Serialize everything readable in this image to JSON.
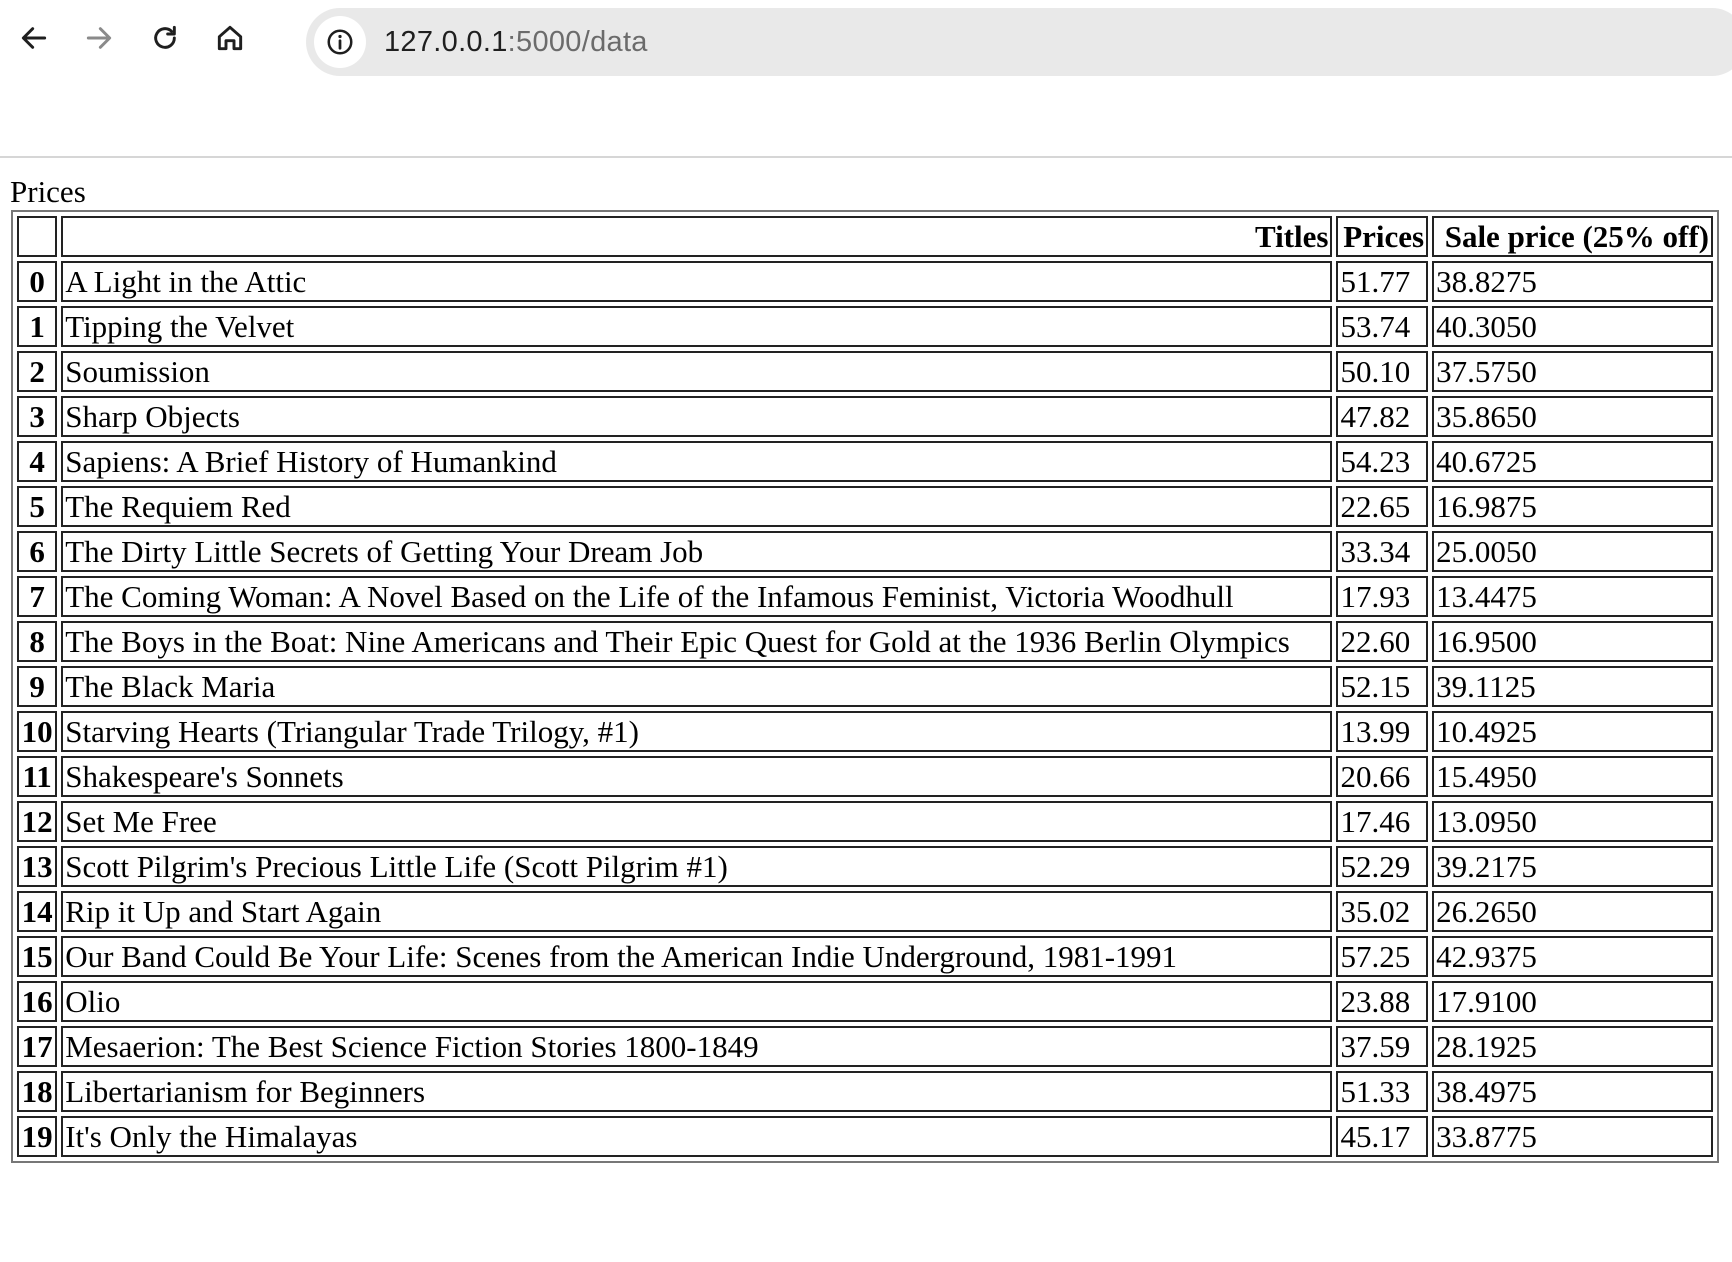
{
  "browser": {
    "back_icon": "arrow-left-icon",
    "forward_icon": "arrow-right-icon",
    "reload_icon": "reload-icon",
    "home_icon": "home-icon",
    "site_info_icon": "info-icon",
    "url_host": "127.0.0.1",
    "url_path": ":5000/data"
  },
  "page": {
    "caption": "Prices",
    "columns": [
      "",
      "Titles",
      "Prices",
      "Sale price (25% off)"
    ],
    "rows": [
      [
        "0",
        "A Light in the Attic",
        "51.77",
        "38.8275"
      ],
      [
        "1",
        "Tipping the Velvet",
        "53.74",
        "40.3050"
      ],
      [
        "2",
        "Soumission",
        "50.10",
        "37.5750"
      ],
      [
        "3",
        "Sharp Objects",
        "47.82",
        "35.8650"
      ],
      [
        "4",
        "Sapiens: A Brief History of Humankind",
        "54.23",
        "40.6725"
      ],
      [
        "5",
        "The Requiem Red",
        "22.65",
        "16.9875"
      ],
      [
        "6",
        "The Dirty Little Secrets of Getting Your Dream Job",
        "33.34",
        "25.0050"
      ],
      [
        "7",
        "The Coming Woman: A Novel Based on the Life of the Infamous Feminist, Victoria Woodhull",
        "17.93",
        "13.4475"
      ],
      [
        "8",
        "The Boys in the Boat: Nine Americans and Their Epic Quest for Gold at the 1936 Berlin Olympics",
        "22.60",
        "16.9500"
      ],
      [
        "9",
        "The Black Maria",
        "52.15",
        "39.1125"
      ],
      [
        "10",
        "Starving Hearts (Triangular Trade Trilogy, #1)",
        "13.99",
        "10.4925"
      ],
      [
        "11",
        "Shakespeare's Sonnets",
        "20.66",
        "15.4950"
      ],
      [
        "12",
        "Set Me Free",
        "17.46",
        "13.0950"
      ],
      [
        "13",
        "Scott Pilgrim's Precious Little Life (Scott Pilgrim #1)",
        "52.29",
        "39.2175"
      ],
      [
        "14",
        "Rip it Up and Start Again",
        "35.02",
        "26.2650"
      ],
      [
        "15",
        "Our Band Could Be Your Life: Scenes from the American Indie Underground, 1981-1991",
        "57.25",
        "42.9375"
      ],
      [
        "16",
        "Olio",
        "23.88",
        "17.9100"
      ],
      [
        "17",
        "Mesaerion: The Best Science Fiction Stories 1800-1849",
        "37.59",
        "28.1925"
      ],
      [
        "18",
        "Libertarianism for Beginners",
        "51.33",
        "38.4975"
      ],
      [
        "19",
        "It's Only the Himalayas",
        "45.17",
        "33.8775"
      ]
    ]
  }
}
